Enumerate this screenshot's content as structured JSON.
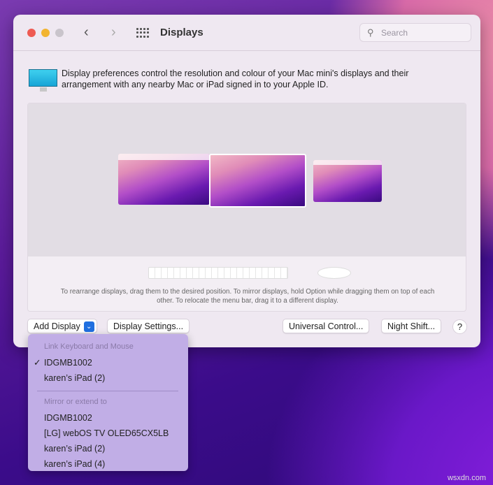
{
  "window": {
    "title": "Displays",
    "search_placeholder": "Search"
  },
  "intro": "Display preferences control the resolution and colour of your Mac mini's displays and their arrangement with any nearby Mac or iPad signed in to your Apple ID.",
  "hint": "To rearrange displays, drag them to the desired position. To mirror displays, hold Option while dragging them on top of each other. To relocate the menu bar, drag it to a different display.",
  "buttons": {
    "add_display": "Add Display",
    "display_settings": "Display Settings...",
    "universal_control": "Universal Control...",
    "night_shift": "Night Shift...",
    "help": "?"
  },
  "menu": {
    "section1": "Link Keyboard and Mouse",
    "link_items": [
      {
        "label": "IDGMB1002",
        "checked": "✓"
      },
      {
        "label": "karen’s iPad (2)"
      }
    ],
    "section2": "Mirror or extend to",
    "mirror_items": [
      "IDGMB1002",
      "[LG] webOS TV OLED65CX5LB",
      "karen’s iPad (2)",
      "karen’s iPad (4)"
    ]
  },
  "watermark": "wsxdn.com"
}
